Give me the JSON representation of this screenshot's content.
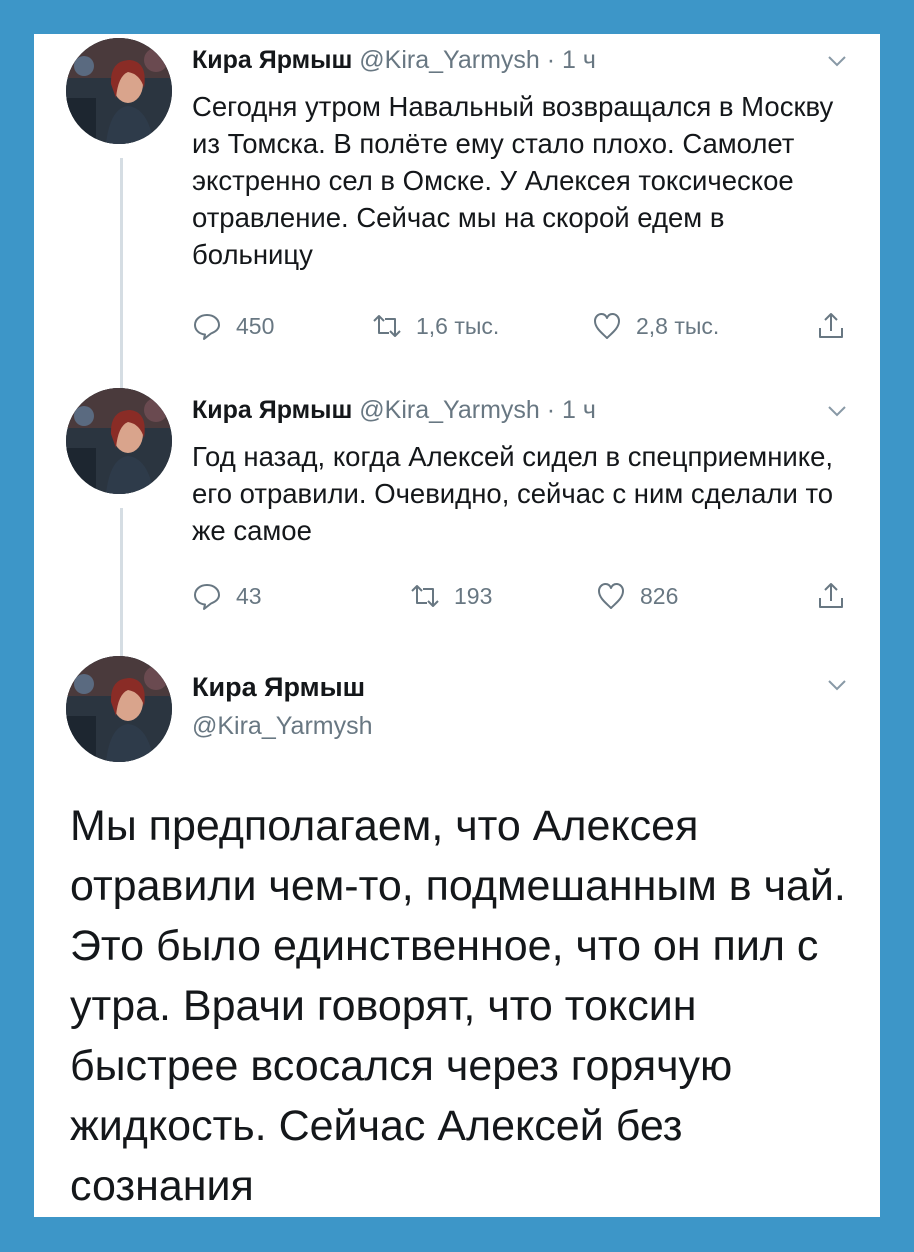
{
  "colors": {
    "background": "#3d96c8",
    "text": "#14171a",
    "muted": "#687782"
  },
  "icons": {
    "reply": "reply-icon",
    "retweet": "retweet-icon",
    "like": "heart-icon",
    "share": "share-icon",
    "more": "chevron-down-icon"
  },
  "tweets": [
    {
      "name": "Кира Ярмыш",
      "handle": "@Kira_Yarmysh",
      "separator": " · ",
      "time": "1 ч",
      "text": "Сегодня утром Навальный возвращался в Москву из Томска. В полёте ему стало плохо. Самолет экстренно сел в Омске. У Алексея токсическое отравление. Сейчас мы на скорой едем в больницу",
      "replies": "450",
      "retweets": "1,6 тыс.",
      "likes": "2,8 тыс."
    },
    {
      "name": "Кира Ярмыш",
      "handle": "@Kira_Yarmysh",
      "separator": " · ",
      "time": "1 ч",
      "text": "Год назад, когда Алексей сидел в спецприемнике, его отравили. Очевидно, сейчас с ним сделали то же самое",
      "replies": "43",
      "retweets": "193",
      "likes": "826"
    }
  ],
  "main_tweet": {
    "name": "Кира Ярмыш",
    "handle": "@Kira_Yarmysh",
    "text": "Мы предполагаем, что Алексея отравили чем-то, подмешанным в чай. Это было единственное, что он пил с утра. Врачи говорят, что токсин быстрее всосался через горячую жидкость. Сейчас Алексей без сознания"
  }
}
